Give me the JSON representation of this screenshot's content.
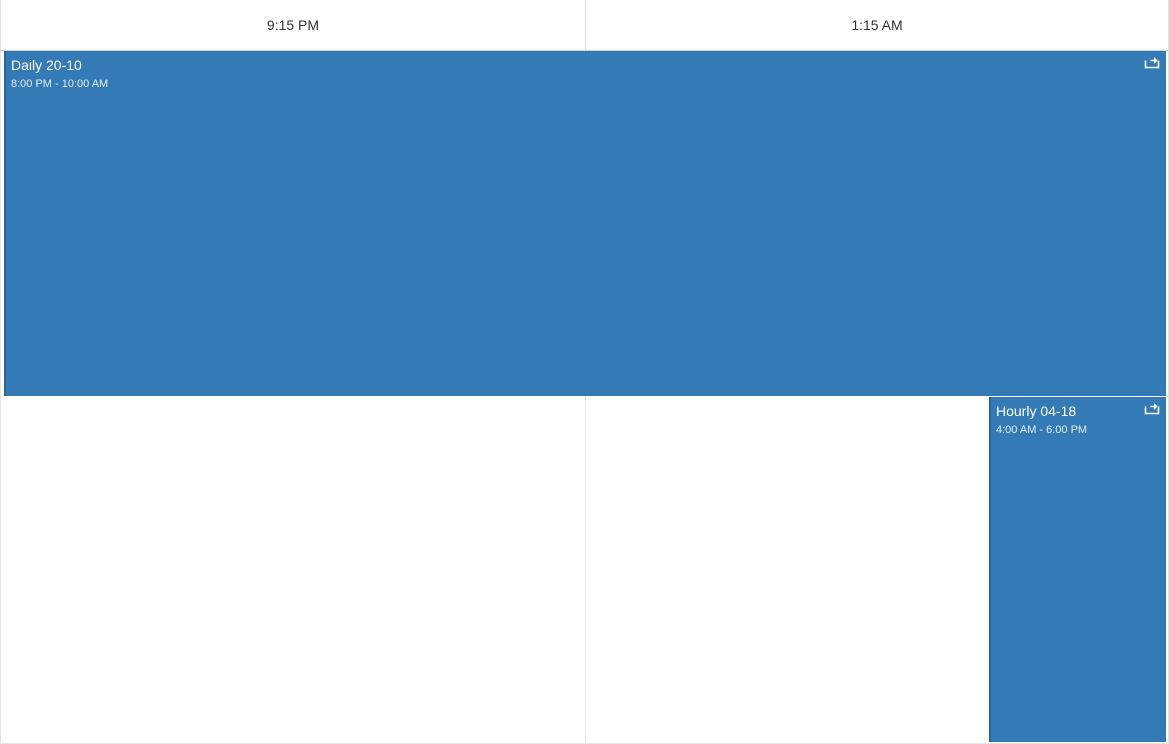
{
  "header": {
    "columns": [
      {
        "label": "9:15 PM"
      },
      {
        "label": "1:15 AM"
      }
    ]
  },
  "events": [
    {
      "title": "Daily 20-10",
      "time": "8:00 PM - 10:00 AM",
      "icon": "recurring-event-icon",
      "color": "#337ab7"
    },
    {
      "title": "Hourly 04-18",
      "time": "4:00 AM - 6:00 PM",
      "icon": "recurring-event-icon",
      "color": "#337ab7"
    }
  ]
}
